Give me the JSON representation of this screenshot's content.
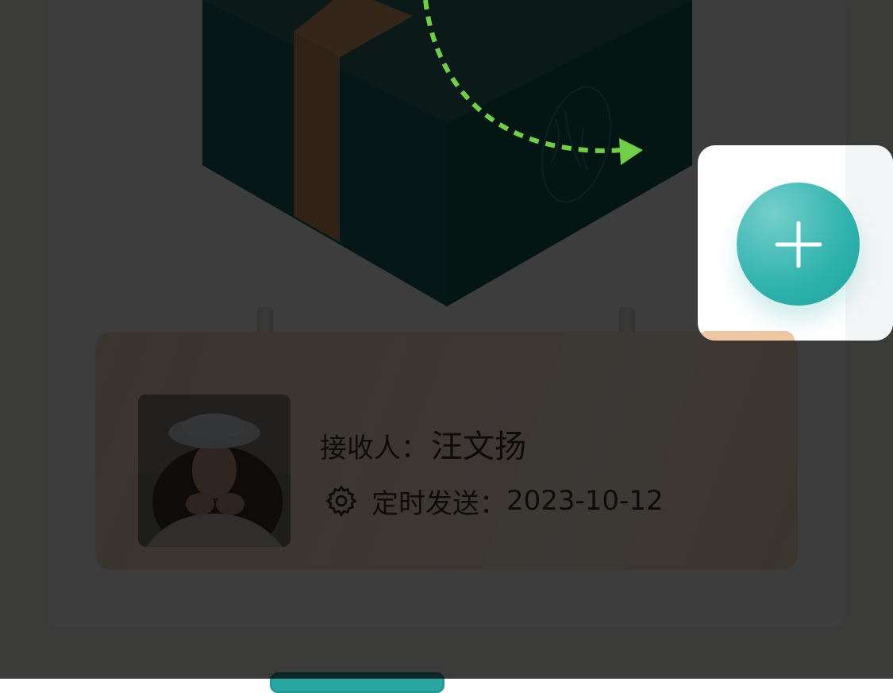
{
  "recipient": {
    "label": "接收人：",
    "name": "汪文扬"
  },
  "schedule": {
    "label": "定时发送：",
    "date": "2023-10-12"
  },
  "icons": {
    "gear": "gear-icon",
    "add": "plus-icon"
  },
  "colors": {
    "accent": "#2fb2ad",
    "arrow": "#6fcf45",
    "overlay": "#000000",
    "tag_card": "#f9e3cf"
  }
}
